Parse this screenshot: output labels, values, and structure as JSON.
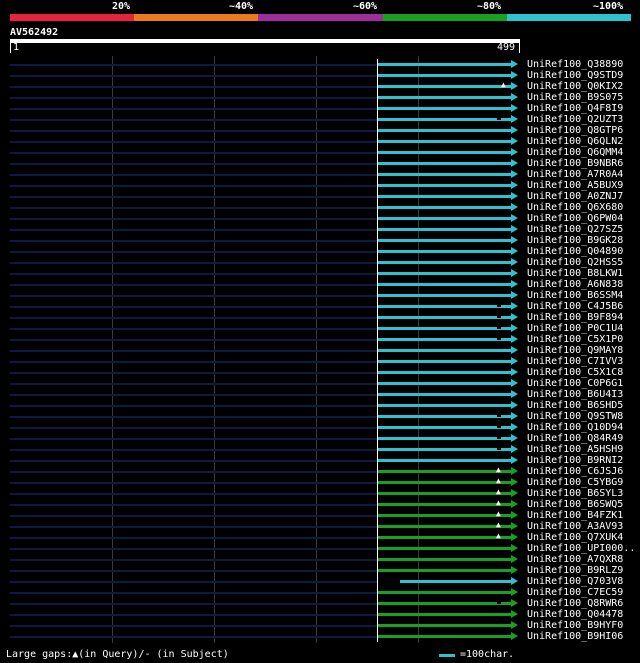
{
  "legend": {
    "labels": [
      "20%",
      "~40%",
      "~60%",
      "~80%",
      "~100%"
    ],
    "colors": [
      "#e8243c",
      "#ed7a1e",
      "#9c2f9b",
      "#19a020",
      "#2cc2cf"
    ]
  },
  "query": {
    "id": "AV562492",
    "start": "1",
    "end": "499"
  },
  "hits": [
    {
      "name": "UniRef100_Q38890",
      "color": "#2cc2cf",
      "gapq": false,
      "gaps": false
    },
    {
      "name": "UniRef100_Q9STD9",
      "color": "#2cc2cf",
      "gapq": false,
      "gaps": false
    },
    {
      "name": "UniRef100_Q0KIX2",
      "color": "#2cc2cf",
      "gapq": true,
      "gaps": false
    },
    {
      "name": "UniRef100_B9S075",
      "color": "#2cc2cf",
      "gapq": false,
      "gaps": false
    },
    {
      "name": "UniRef100_Q4F8I9",
      "color": "#2cc2cf",
      "gapq": false,
      "gaps": false
    },
    {
      "name": "UniRef100_Q2UZT3",
      "color": "#2cc2cf",
      "gapq": false,
      "gaps": true
    },
    {
      "name": "UniRef100_Q8GTP6",
      "color": "#2cc2cf",
      "gapq": false,
      "gaps": false
    },
    {
      "name": "UniRef100_Q6QLN2",
      "color": "#2cc2cf",
      "gapq": false,
      "gaps": false
    },
    {
      "name": "UniRef100_Q6QMM4",
      "color": "#2cc2cf",
      "gapq": false,
      "gaps": false
    },
    {
      "name": "UniRef100_B9NBR6",
      "color": "#2cc2cf",
      "gapq": false,
      "gaps": false
    },
    {
      "name": "UniRef100_A7R0A4",
      "color": "#2cc2cf",
      "gapq": false,
      "gaps": false
    },
    {
      "name": "UniRef100_A5BUX9",
      "color": "#2cc2cf",
      "gapq": false,
      "gaps": false
    },
    {
      "name": "UniRef100_A0ZNJ7",
      "color": "#2cc2cf",
      "gapq": false,
      "gaps": false
    },
    {
      "name": "UniRef100_Q6X680",
      "color": "#2cc2cf",
      "gapq": false,
      "gaps": false
    },
    {
      "name": "UniRef100_Q6PW04",
      "color": "#2cc2cf",
      "gapq": false,
      "gaps": false
    },
    {
      "name": "UniRef100_Q27SZ5",
      "color": "#2cc2cf",
      "gapq": false,
      "gaps": false
    },
    {
      "name": "UniRef100_B9GK28",
      "color": "#2cc2cf",
      "gapq": false,
      "gaps": false
    },
    {
      "name": "UniRef100_Q04890",
      "color": "#2cc2cf",
      "gapq": false,
      "gaps": false
    },
    {
      "name": "UniRef100_Q2HSS5",
      "color": "#2cc2cf",
      "gapq": false,
      "gaps": false
    },
    {
      "name": "UniRef100_B8LKW1",
      "color": "#2cc2cf",
      "gapq": false,
      "gaps": false
    },
    {
      "name": "UniRef100_A6N838",
      "color": "#2cc2cf",
      "gapq": false,
      "gaps": false
    },
    {
      "name": "UniRef100_B6SSM4",
      "color": "#2cc2cf",
      "gapq": false,
      "gaps": false
    },
    {
      "name": "UniRef100_C4J5B6",
      "color": "#2cc2cf",
      "gapq": false,
      "gaps": true
    },
    {
      "name": "UniRef100_B9F894",
      "color": "#2cc2cf",
      "gapq": false,
      "gaps": true
    },
    {
      "name": "UniRef100_P0C1U4",
      "color": "#2cc2cf",
      "gapq": false,
      "gaps": true
    },
    {
      "name": "UniRef100_C5X1P0",
      "color": "#2cc2cf",
      "gapq": false,
      "gaps": true
    },
    {
      "name": "UniRef100_Q9MAY8",
      "color": "#2cc2cf",
      "gapq": false,
      "gaps": false
    },
    {
      "name": "UniRef100_C7IVV3",
      "color": "#2cc2cf",
      "gapq": false,
      "gaps": false
    },
    {
      "name": "UniRef100_C5X1C8",
      "color": "#2cc2cf",
      "gapq": false,
      "gaps": false
    },
    {
      "name": "UniRef100_C0P6G1",
      "color": "#2cc2cf",
      "gapq": false,
      "gaps": false
    },
    {
      "name": "UniRef100_B6U4I3",
      "color": "#2cc2cf",
      "gapq": false,
      "gaps": false
    },
    {
      "name": "UniRef100_B6SHD5",
      "color": "#2cc2cf",
      "gapq": false,
      "gaps": false
    },
    {
      "name": "UniRef100_Q9STW8",
      "color": "#2cc2cf",
      "gapq": false,
      "gaps": true
    },
    {
      "name": "UniRef100_Q10D94",
      "color": "#2cc2cf",
      "gapq": false,
      "gaps": true
    },
    {
      "name": "UniRef100_Q84R49",
      "color": "#2cc2cf",
      "gapq": false,
      "gaps": true
    },
    {
      "name": "UniRef100_A5HSH9",
      "color": "#2cc2cf",
      "gapq": false,
      "gaps": true
    },
    {
      "name": "UniRef100_B9RNI2",
      "color": "#2cc2cf",
      "gapq": false,
      "gaps": false
    },
    {
      "name": "UniRef100_C6JSJ6",
      "color": "#19a020",
      "gapq": true,
      "gaps": false
    },
    {
      "name": "UniRef100_C5YBG9",
      "color": "#19a020",
      "gapq": true,
      "gaps": false
    },
    {
      "name": "UniRef100_B6SYL3",
      "color": "#19a020",
      "gapq": true,
      "gaps": false
    },
    {
      "name": "UniRef100_B6SWQ5",
      "color": "#19a020",
      "gapq": true,
      "gaps": false
    },
    {
      "name": "UniRef100_B4FZK1",
      "color": "#19a020",
      "gapq": true,
      "gaps": false
    },
    {
      "name": "UniRef100_A3AV93",
      "color": "#19a020",
      "gapq": true,
      "gaps": false
    },
    {
      "name": "UniRef100_Q7XUK4",
      "color": "#19a020",
      "gapq": true,
      "gaps": false
    },
    {
      "name": "UniRef100_UPI000..",
      "color": "#19a020",
      "gapq": false,
      "gaps": false
    },
    {
      "name": "UniRef100_A7QXR8",
      "color": "#19a020",
      "gapq": false,
      "gaps": false
    },
    {
      "name": "UniRef100_B9RLZ9",
      "color": "#19a020",
      "gapq": false,
      "gaps": false
    },
    {
      "name": "UniRef100_Q703V8",
      "color": "#2cc2cf",
      "gapq": false,
      "gaps": false,
      "short": true
    },
    {
      "name": "UniRef100_C7EC59",
      "color": "#19a020",
      "gapq": false,
      "gaps": false
    },
    {
      "name": "UniRef100_Q8RWR6",
      "color": "#19a020",
      "gapq": false,
      "gaps": true
    },
    {
      "name": "UniRef100_Q04478",
      "color": "#19a020",
      "gapq": false,
      "gaps": false
    },
    {
      "name": "UniRef100_B9HYF0",
      "color": "#19a020",
      "gapq": false,
      "gaps": false
    },
    {
      "name": "UniRef100_B9HI06",
      "color": "#19a020",
      "gapq": false,
      "gaps": false
    }
  ],
  "footer": {
    "gaps_text": "Large gaps:▲(in Query)/- (in Subject)",
    "scale_text": "=100char."
  }
}
